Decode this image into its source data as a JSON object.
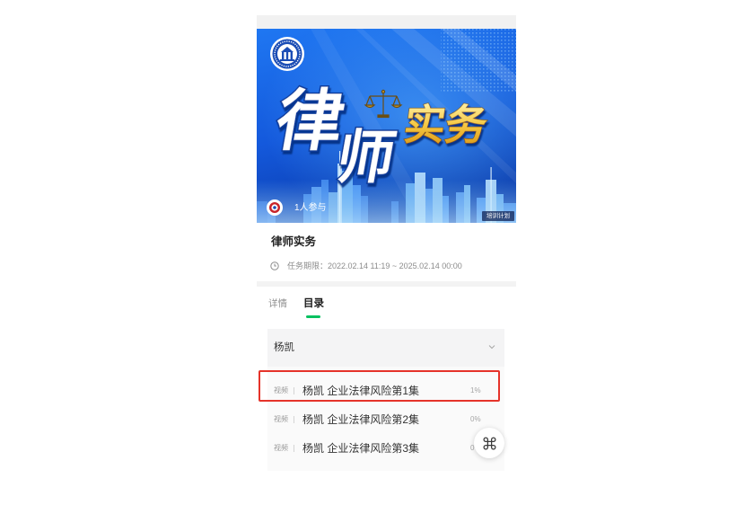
{
  "banner": {
    "title_big": [
      "律",
      "师"
    ],
    "title_gold": "实务",
    "participants": "1人参与",
    "tag": "培训计划"
  },
  "course": {
    "title": "律师实务",
    "deadline": "任务期限：2022.02.14 11:19 ~ 2025.02.14 00:00"
  },
  "tabs": [
    {
      "label": "详情",
      "active": false
    },
    {
      "label": "目录",
      "active": true
    }
  ],
  "catalog": {
    "section_title": "杨凯",
    "expanded": true,
    "items": [
      {
        "type": "视频",
        "title": "杨凯 企业法律风险第1集",
        "progress": "1%",
        "highlighted": true
      },
      {
        "type": "视频",
        "title": "杨凯 企业法律风险第2集",
        "progress": "0%",
        "highlighted": false
      },
      {
        "type": "视频",
        "title": "杨凯 企业法律风险第3集",
        "progress": "0%",
        "highlighted": false
      }
    ]
  },
  "icons": {
    "deadline": "clock-icon",
    "section_toggle": "chevron-down-icon",
    "floating_menu": "command-icon",
    "banner_emblem": "court-emblem-logo",
    "banner_scales": "scales-icon",
    "participant_avatar": "avatar"
  },
  "colors": {
    "accent": "#07c160",
    "highlight": "#e5332a",
    "banner_blue": "#1660e0",
    "banner_gold": "#f6c843",
    "text_primary": "#1f1f1f",
    "text_secondary": "#8c8c8c"
  }
}
